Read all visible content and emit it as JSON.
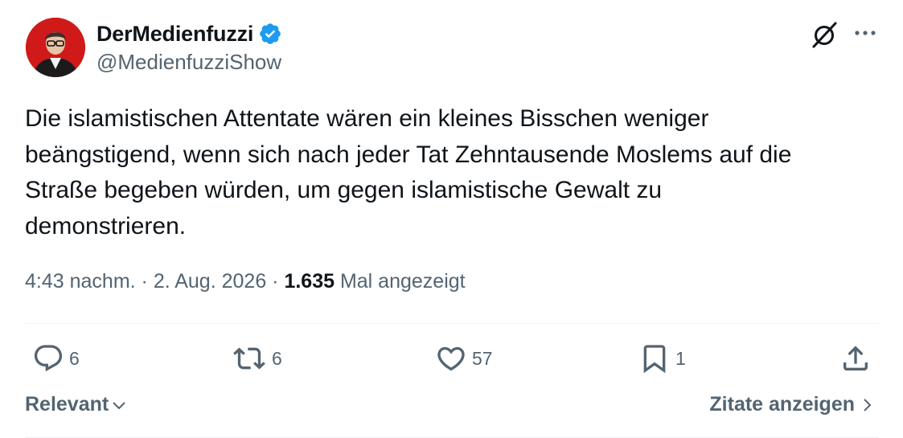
{
  "author": {
    "display_name": "DerMedienfuzzi",
    "handle": "@MedienfuzziShow",
    "verified": true,
    "verified_color": "#1d9bf0",
    "avatar_bg": "#d01a1a"
  },
  "header_icons": {
    "grok": "grok-icon",
    "more": "more-icon"
  },
  "tweet": {
    "lines": [
      "Die islamistischen Attentate wären ein kleines Bisschen weniger",
      "beängstigend, wenn sich nach jeder Tat Zehntausende Moslems auf die",
      "Straße begeben würden, um gegen islamistische Gewalt zu",
      "demonstrieren."
    ]
  },
  "meta": {
    "time": "4:43 nachm.",
    "separator": " · ",
    "date": "2. Aug. 2026",
    "views_count": "1.635",
    "views_label": "Mal angezeigt"
  },
  "actions": {
    "replies": {
      "icon": "reply-icon",
      "count": "6"
    },
    "reposts": {
      "icon": "repost-icon",
      "count": "6"
    },
    "likes": {
      "icon": "heart-icon",
      "count": "57"
    },
    "bookmarks": {
      "icon": "bookmark-icon",
      "count": "1"
    },
    "share": {
      "icon": "share-icon"
    }
  },
  "footer": {
    "sort_label": "Relevant",
    "quotes_label": "Zitate anzeigen"
  },
  "colors": {
    "text": "#0f1419",
    "secondary": "#536471",
    "divider": "#eff3f4"
  }
}
